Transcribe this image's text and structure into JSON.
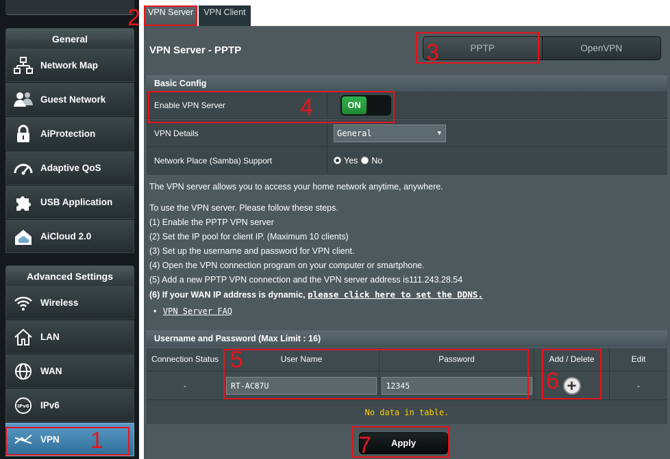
{
  "sidebar": {
    "general_header": "General",
    "general_items": [
      {
        "label": "Network Map",
        "icon": "network-map-icon"
      },
      {
        "label": "Guest Network",
        "icon": "guest-network-icon"
      },
      {
        "label": "AiProtection",
        "icon": "lock-icon"
      },
      {
        "label": "Adaptive QoS",
        "icon": "speedometer-icon"
      },
      {
        "label": "USB Application",
        "icon": "puzzle-icon"
      },
      {
        "label": "AiCloud 2.0",
        "icon": "cloud-icon"
      }
    ],
    "advanced_header": "Advanced Settings",
    "advanced_items": [
      {
        "label": "Wireless",
        "icon": "wifi-icon"
      },
      {
        "label": "LAN",
        "icon": "home-icon"
      },
      {
        "label": "WAN",
        "icon": "globe-icon"
      },
      {
        "label": "IPv6",
        "icon": "ipv6-globe-icon"
      },
      {
        "label": "VPN",
        "icon": "vpn-icon",
        "active": true
      }
    ]
  },
  "tabs": [
    "VPN Server",
    "VPN Client"
  ],
  "main": {
    "title": "VPN Server - PPTP",
    "modes": [
      "PPTP",
      "OpenVPN"
    ],
    "basic_config": "Basic Config",
    "enable_label": "Enable VPN Server",
    "enable_value": "ON",
    "details_label": "VPN Details",
    "details_value": "General",
    "samba_label": "Network Place (Samba) Support",
    "samba_yes": "Yes",
    "samba_no": "No",
    "intro": "The VPN server allows you to access your home network anytime, anywhere.",
    "steps_intro": "To use the VPN server. Please follow these steps.",
    "steps": [
      "(1) Enable the PPTP VPN server",
      "(2) Set the IP pool for client IP. (Maximum 10 clients)",
      "(3) Set up the username and password for VPN client.",
      "(4) Open the VPN connection program on your computer or smartphone.",
      "(5) Add a new PPTP VPN connection and the VPN server address is111.243.28.54"
    ],
    "step6_text": "(6) If your WAN IP address is dynamic,",
    "step6_link": "please click here to set the DDNS.",
    "faq_bullet": "•",
    "faq_link": "VPN Server FAQ",
    "userpass_header": "Username and Password (Max Limit : 16)",
    "table_headers": [
      "Connection Status",
      "User Name",
      "Password",
      "Add / Delete",
      "Edit"
    ],
    "row_status": "-",
    "row_username": "RT-AC87U",
    "row_password": "12345",
    "row_add_symbol": "+",
    "row_edit": "-",
    "no_data": "No data in table.",
    "apply": "Apply"
  },
  "annotations": [
    "1",
    "2",
    "3",
    "4",
    "5",
    "6",
    "7"
  ],
  "colors": {
    "annotation": "#e5141c",
    "switch_on": "#2fb04a",
    "no_data": "#ffcc00",
    "active_nav": "#3f82b0"
  }
}
